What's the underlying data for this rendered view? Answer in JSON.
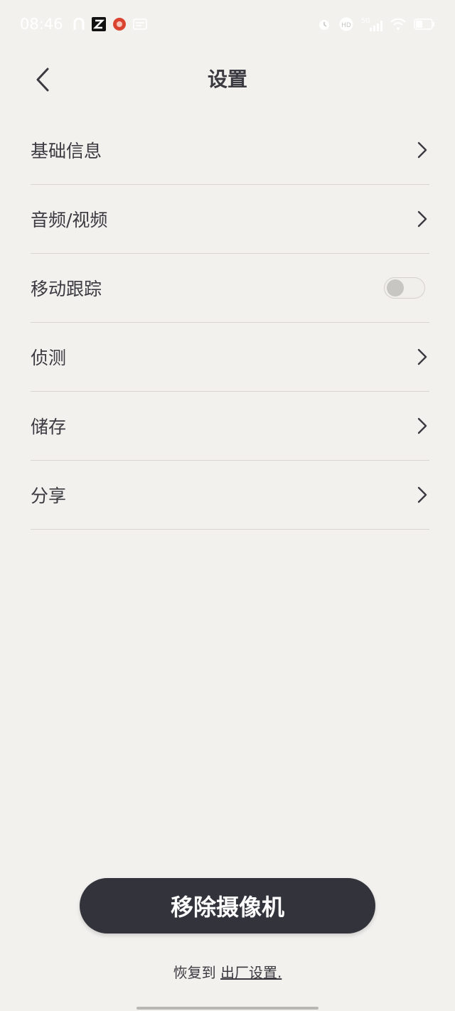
{
  "status_bar": {
    "time": "08:46",
    "network": "5G",
    "hd_badge": "HD"
  },
  "header": {
    "title": "设置"
  },
  "settings": {
    "items": [
      {
        "label": "基础信息",
        "control": "chevron"
      },
      {
        "label": "音频/视频",
        "control": "chevron"
      },
      {
        "label": "移动跟踪",
        "control": "toggle",
        "toggle_on": false
      },
      {
        "label": "侦测",
        "control": "chevron"
      },
      {
        "label": "储存",
        "control": "chevron"
      },
      {
        "label": "分享",
        "control": "chevron"
      }
    ]
  },
  "actions": {
    "remove_label": "移除摄像机",
    "reset_prefix": "恢复到",
    "reset_link": "出厂设置."
  },
  "colors": {
    "background": "#f3f1ee",
    "primary_button": "#33333c",
    "text": "#3a3a40",
    "divider": "#d9d6d2"
  }
}
